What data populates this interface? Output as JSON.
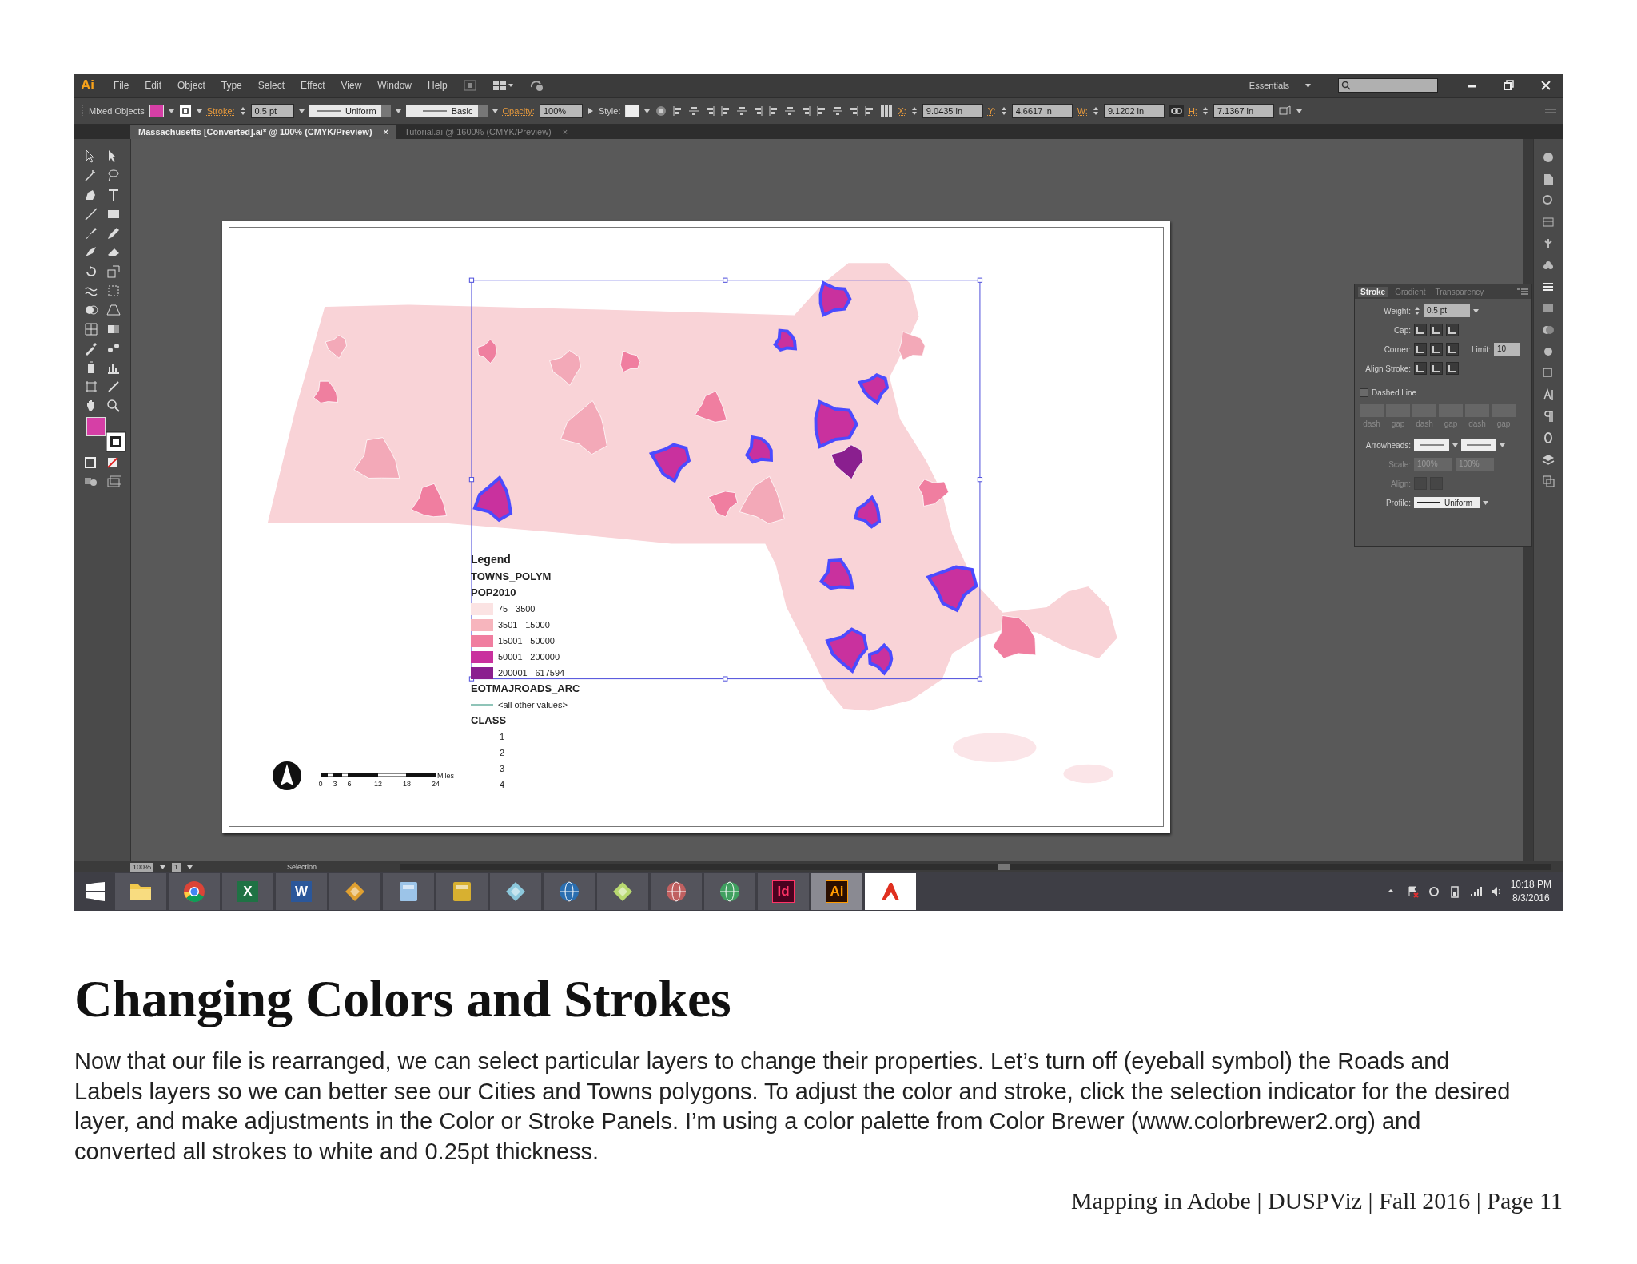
{
  "app": {
    "logo": "Ai",
    "menu": [
      "File",
      "Edit",
      "Object",
      "Type",
      "Select",
      "Effect",
      "View",
      "Window",
      "Help"
    ],
    "workspace": "Essentials",
    "control_bar": {
      "selection": "Mixed Objects",
      "stroke_label": "Stroke:",
      "stroke_weight": "0.5 pt",
      "profile": "Uniform",
      "brush": "Basic",
      "opacity_label": "Opacity:",
      "opacity": "100%",
      "style_label": "Style:",
      "fields": [
        {
          "label": "X:",
          "value": "9.0435 in"
        },
        {
          "label": "Y:",
          "value": "4.6617 in"
        },
        {
          "label": "W:",
          "value": "9.1202 in"
        },
        {
          "label": "H:",
          "value": "7.1367 in"
        }
      ]
    },
    "doc_tabs": [
      {
        "label": "Massachusetts [Converted].ai* @ 100% (CMYK/Preview)",
        "close": "×",
        "selected": true
      },
      {
        "label": "Tutorial.ai @ 1600% (CMYK/Preview)",
        "close": "×",
        "selected": false
      }
    ],
    "legend": {
      "title": "Legend",
      "layer": "TOWNS_POLYM",
      "field": "POP2010",
      "classes": [
        {
          "label": "75 - 3500",
          "color": "#fbe3e3"
        },
        {
          "label": "3501 - 15000",
          "color": "#f7b5bd"
        },
        {
          "label": "15001 - 50000",
          "color": "#f07ea0"
        },
        {
          "label": "50001 - 200000",
          "color": "#c9319e"
        },
        {
          "label": "200001 - 617594",
          "color": "#8a1f8f"
        }
      ],
      "roads_layer": "EOTMAJROADS_ARC",
      "roads_value": "<all other values>",
      "class_title": "CLASS",
      "class_values": [
        "1",
        "2",
        "3",
        "4"
      ]
    },
    "scale_bar": {
      "ticks": [
        "0",
        "3",
        "6",
        "12",
        "18",
        "24"
      ],
      "unit": "Miles"
    },
    "stroke_panel": {
      "tabs": [
        {
          "label": "Stroke",
          "selected": true
        },
        {
          "label": "Gradient",
          "selected": false
        },
        {
          "label": "Transparency",
          "selected": false
        }
      ],
      "rows": [
        {
          "kind": "field",
          "label": "Weight:",
          "value": "0.5 pt",
          "disabled": false
        },
        {
          "kind": "buttons",
          "label": "Cap:",
          "disabled": false
        },
        {
          "kind": "limit",
          "label": "Corner:",
          "extra_label": "Limit:",
          "extra_value": "10",
          "disabled": false
        },
        {
          "kind": "buttons",
          "label": "Align Stroke:",
          "disabled": false
        },
        {
          "kind": "checkbox",
          "label": "Dashed Line",
          "checked": false
        },
        {
          "kind": "dashes",
          "labels": [
            "dash",
            "gap",
            "dash",
            "gap",
            "dash",
            "gap"
          ],
          "disabled": true
        },
        {
          "kind": "arrows",
          "label": "Arrowheads:",
          "disabled": false
        },
        {
          "kind": "scale",
          "label": "Scale:",
          "values": [
            "100%",
            "100%"
          ],
          "disabled": true
        },
        {
          "kind": "pair",
          "label": "Align:",
          "disabled": true
        },
        {
          "kind": "profile",
          "label": "Profile:",
          "value": "Uniform",
          "disabled": false
        }
      ]
    },
    "status_bar": {
      "zoom": "100%",
      "artboard": "1",
      "tool": "Selection"
    },
    "taskbar": {
      "apps": [
        {
          "kind": "folder",
          "color": "#f2c94c",
          "selected": false
        },
        {
          "kind": "chrome",
          "color": "#db4437",
          "selected": false
        },
        {
          "kind": "letter",
          "label": "X",
          "color": "#1f7244",
          "selected": false
        },
        {
          "kind": "letter",
          "label": "W",
          "color": "#2b579a",
          "selected": false
        },
        {
          "kind": "diamond",
          "color": "#e0a030",
          "selected": false
        },
        {
          "kind": "tile",
          "color": "#9cc4e8",
          "selected": false
        },
        {
          "kind": "tile",
          "color": "#d8b030",
          "selected": false
        },
        {
          "kind": "diamond",
          "color": "#8cc8dc",
          "selected": false
        },
        {
          "kind": "globe",
          "color": "#2a6eb0",
          "selected": false
        },
        {
          "kind": "diamond",
          "color": "#b8d870",
          "selected": false
        },
        {
          "kind": "globe",
          "color": "#c06060",
          "selected": false
        },
        {
          "kind": "globe",
          "color": "#40a060",
          "selected": false
        },
        {
          "kind": "letter",
          "label": "Id",
          "color": "#49021f",
          "selected": false
        },
        {
          "kind": "letter",
          "label": "Ai",
          "color": "#2b0f00",
          "selected": true
        },
        {
          "kind": "pdf",
          "color": "#e03020",
          "selected": false
        }
      ],
      "time": "10:18 PM",
      "date": "8/3/2016"
    }
  },
  "heading": "Changing Colors and Strokes",
  "paragraph": "Now that our file is rearranged, we can select particular layers to change their properties. Let’s turn off (eyeball symbol) the Roads and Labels layers so we can better see our Cities and Towns polygons. To adjust the color and stroke, click the selection indicator for the desired layer, and make adjustments in the Color or Stroke Panels. I’m using a color palette from Color Brewer (www.colorbrewer2.org) and converted all strokes to white and 0.25pt thickness.",
  "footer": "Mapping in Adobe | DUSPViz | Fall 2016 | Page 11"
}
